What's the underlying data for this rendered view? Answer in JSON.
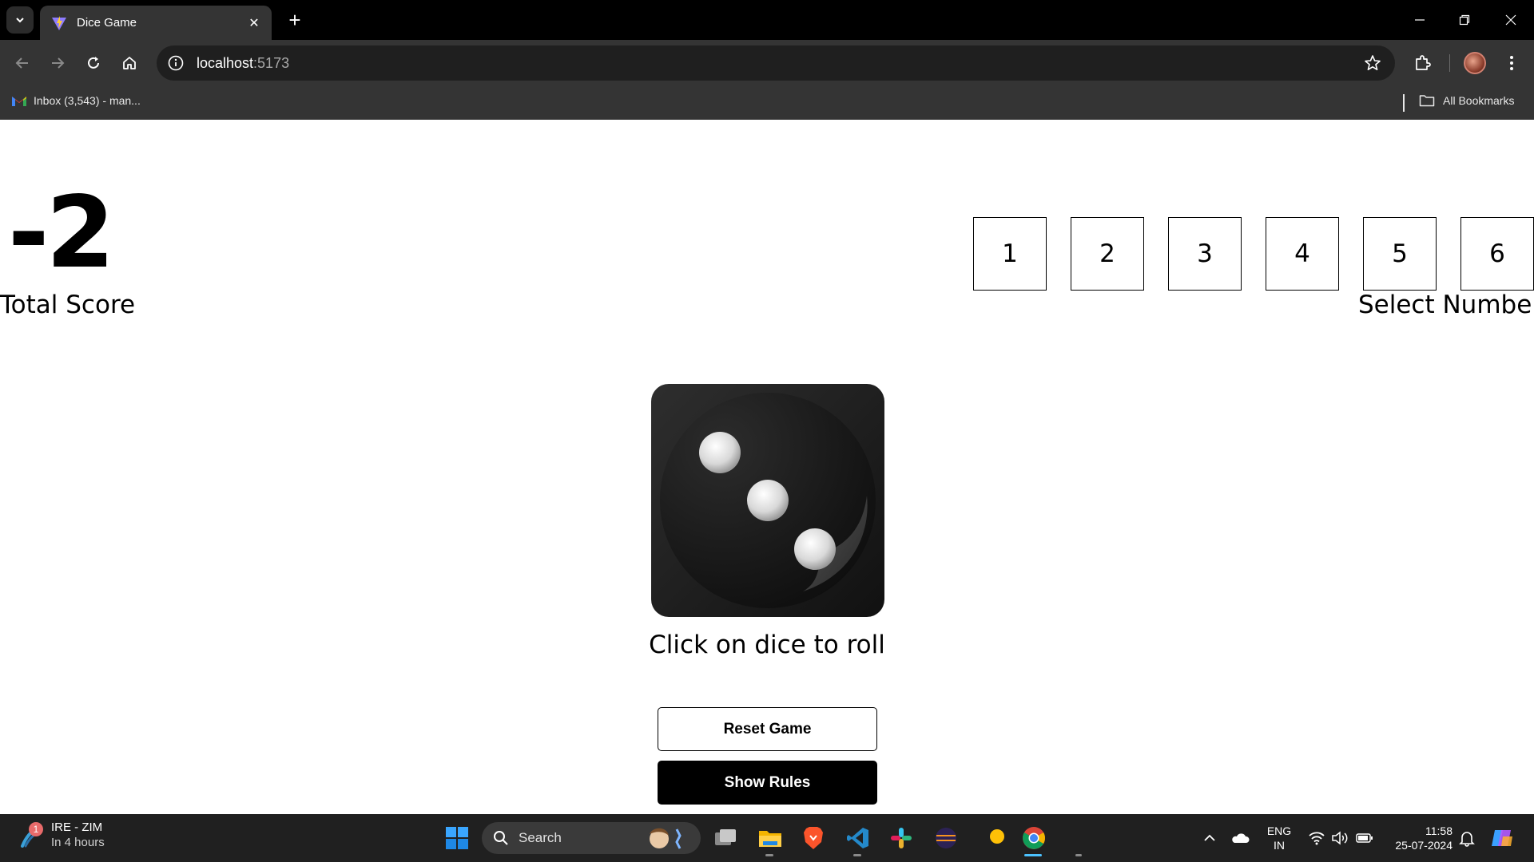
{
  "browser": {
    "tab_title": "Dice Game",
    "url_host": "localhost",
    "url_port": ":5173",
    "bookmark_inbox": "Inbox (3,543) - man...",
    "bookmark_all": "All Bookmarks"
  },
  "game": {
    "total_score": "-2",
    "total_score_label": "Total Score",
    "numbers": [
      "1",
      "2",
      "3",
      "4",
      "5",
      "6"
    ],
    "select_number_label": "Select Number",
    "dice_face": 3,
    "roll_hint": "Click on dice to roll",
    "reset_button": "Reset Game",
    "rules_button": "Show Rules"
  },
  "taskbar": {
    "widget_badge": "1",
    "widget_title": "IRE - ZIM",
    "widget_subtitle": "In 4 hours",
    "search_label": "Search",
    "language": "ENG",
    "region": "IN",
    "time": "11:58",
    "date": "25-07-2024"
  },
  "colors": {
    "chrome_bg": "#343434",
    "tabstrip_bg": "#000000",
    "taskbar_bg": "#202020",
    "dice_bg": "#1a1a1a"
  }
}
